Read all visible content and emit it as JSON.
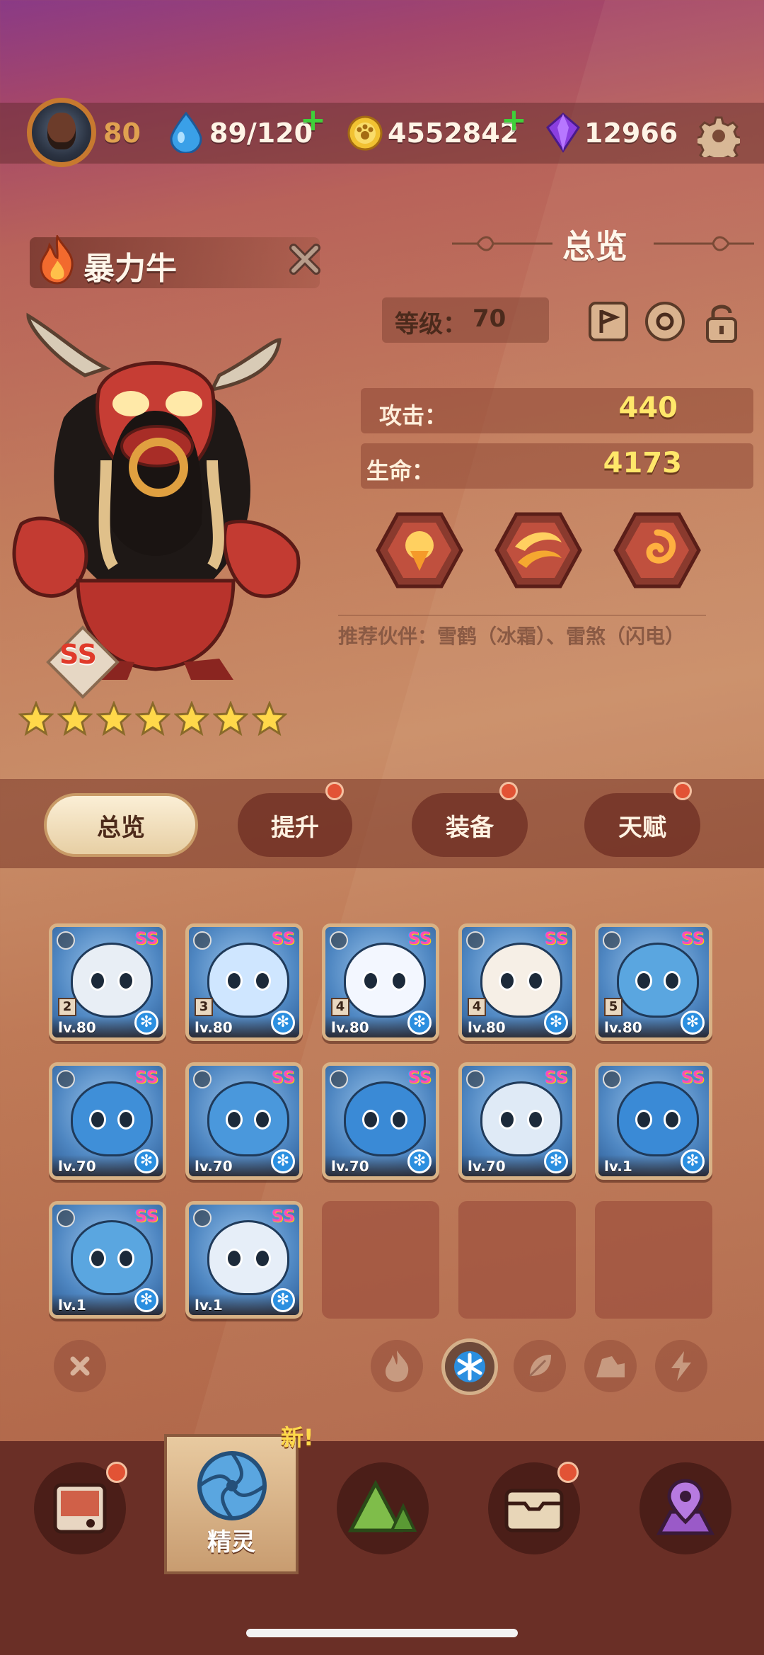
{
  "topbar": {
    "player_level": "80",
    "energy": "89/120",
    "coins": "4552842",
    "gems": "12966"
  },
  "hero": {
    "name": "暴力牛",
    "rank": "SS",
    "stars": 7
  },
  "overview": {
    "title": "总览",
    "level_label": "等级：",
    "level_value": "70",
    "attack_label": "攻击：",
    "attack_value": "440",
    "hp_label": "生命：",
    "hp_value": "4173",
    "partner_text": "推荐伙伴：雪鹤（冰霜）、雷煞（闪电）"
  },
  "tabs": [
    {
      "label": "总览",
      "active": true,
      "badge": false
    },
    {
      "label": "提升",
      "active": false,
      "badge": true
    },
    {
      "label": "装备",
      "active": false,
      "badge": true
    },
    {
      "label": "天赋",
      "active": false,
      "badge": true
    }
  ],
  "cards": [
    {
      "level": "lv.80",
      "num": "2",
      "locked": true,
      "rank": "SS",
      "element": "ice",
      "color": "#e8eef5"
    },
    {
      "level": "lv.80",
      "num": "3",
      "locked": true,
      "rank": "SS",
      "element": "ice",
      "color": "#cfe6ff"
    },
    {
      "level": "lv.80",
      "num": "4",
      "locked": true,
      "rank": "SS",
      "element": "ice",
      "color": "#f3f7ff"
    },
    {
      "level": "lv.80",
      "num": "4",
      "locked": true,
      "rank": "SS",
      "element": "ice",
      "color": "#f6efe6"
    },
    {
      "level": "lv.80",
      "num": "5",
      "locked": true,
      "rank": "SS",
      "element": "ice",
      "color": "#5aa6e0"
    },
    {
      "level": "lv.70",
      "num": "",
      "locked": true,
      "rank": "SS",
      "element": "ice",
      "color": "#3f8fd8"
    },
    {
      "level": "lv.70",
      "num": "",
      "locked": true,
      "rank": "SS",
      "element": "ice",
      "color": "#4a98dc"
    },
    {
      "level": "lv.70",
      "num": "",
      "locked": true,
      "rank": "SS",
      "element": "ice",
      "color": "#3a8ad6"
    },
    {
      "level": "lv.70",
      "num": "",
      "locked": true,
      "rank": "SS",
      "element": "ice",
      "color": "#dfeaf6"
    },
    {
      "level": "lv.1",
      "num": "",
      "locked": true,
      "rank": "SS",
      "element": "ice",
      "color": "#3a8ad6"
    },
    {
      "level": "lv.1",
      "num": "",
      "locked": true,
      "rank": "SS",
      "element": "ice",
      "color": "#5aa6e0"
    },
    {
      "level": "lv.1",
      "num": "",
      "locked": true,
      "rank": "SS",
      "element": "ice",
      "color": "#e6eef8"
    }
  ],
  "filters": [
    "clear-icon",
    "fire-icon",
    "ice-icon",
    "leaf-icon",
    "earth-icon",
    "lightning-icon"
  ],
  "bottom_nav": {
    "selected_label": "精灵",
    "new_badge": "新!"
  },
  "colors": {
    "accent_gold": "#ffe76a",
    "badge_red": "#e25335",
    "plus_green": "#3fcf3a"
  }
}
